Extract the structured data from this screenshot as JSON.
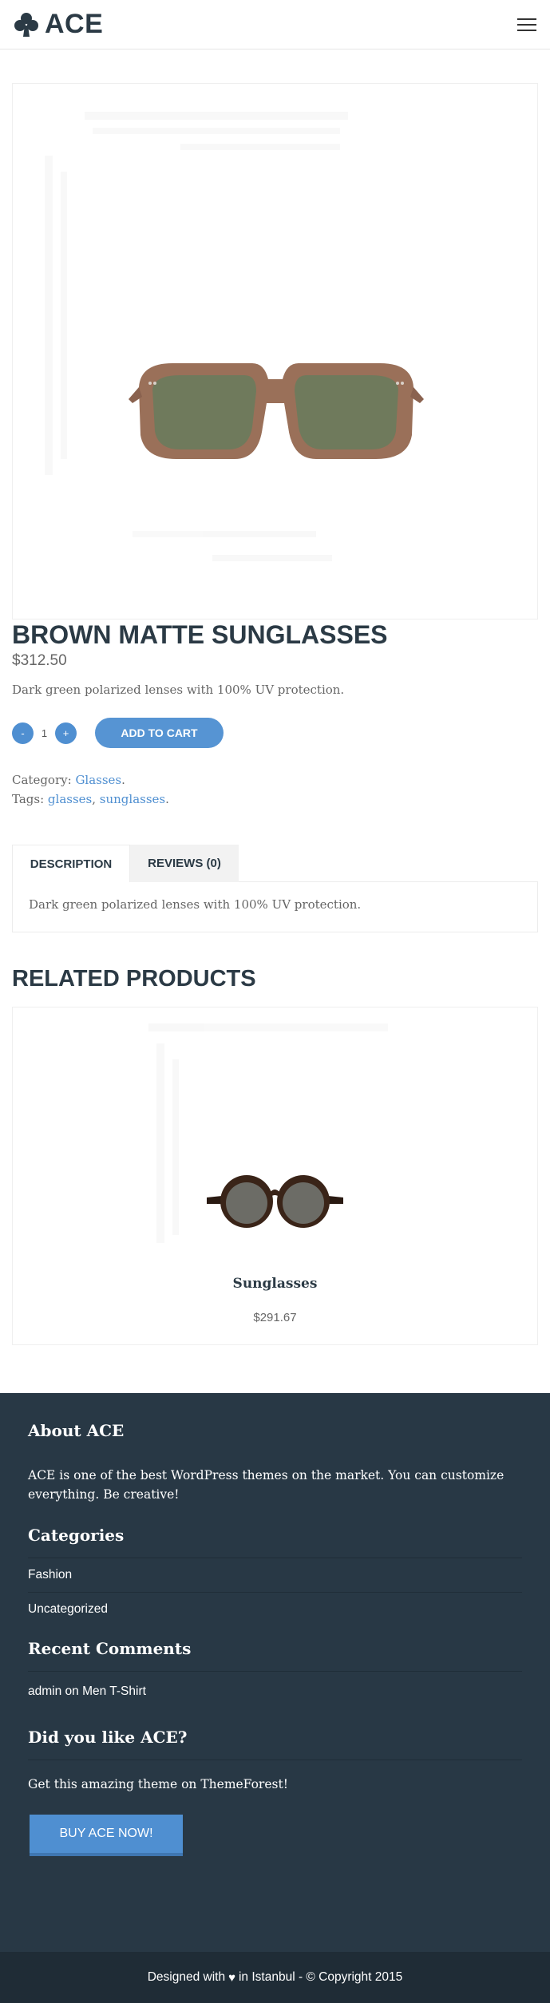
{
  "header": {
    "brand": "ACE",
    "logo_icon": "club-icon",
    "menu_icon": "hamburger-menu-icon"
  },
  "product": {
    "image_alt": "brown-matte-sunglasses-image",
    "title": "BROWN MATTE SUNGLASSES",
    "price": "$312.50",
    "short_description": "Dark green polarized lenses with 100% UV protection.",
    "quantity": "1",
    "minus_label": "-",
    "plus_label": "+",
    "add_to_cart_label": "Add to cart",
    "category_label": "Category:",
    "category": "Glasses",
    "tags_label": "Tags:",
    "tags": [
      "glasses",
      "sunglasses"
    ],
    "tabs": [
      {
        "label": "DESCRIPTION",
        "active": true
      },
      {
        "label": "REVIEWS (0)",
        "active": false
      }
    ],
    "tab_content": "Dark green polarized lenses with 100% UV protection."
  },
  "related": {
    "heading": "RELATED PRODUCTS",
    "items": [
      {
        "name": "Sunglasses",
        "price": "$291.67"
      }
    ]
  },
  "footer": {
    "about_title": "About ACE",
    "about_text": "ACE is one of the best WordPress themes on the market. You can customize everything. Be creative!",
    "categories_title": "Categories",
    "categories": [
      "Fashion",
      "Uncategorized"
    ],
    "recent_comments_title": "Recent Comments",
    "comment_author": "admin",
    "comment_on": "on",
    "comment_post": "Men T-Shirt",
    "like_title": "Did you like ACE?",
    "like_text": "Get this amazing theme on ThemeForest!",
    "buy_label": "Buy ACE now!",
    "copyright_before": "Designed with",
    "copyright_after": "in Istanbul - © Copyright 2015"
  },
  "colors": {
    "accent": "#4f8fd1",
    "heading": "#2b3a45",
    "footer_bg": "#283845",
    "bottom_bar_bg": "#1f2c36"
  }
}
